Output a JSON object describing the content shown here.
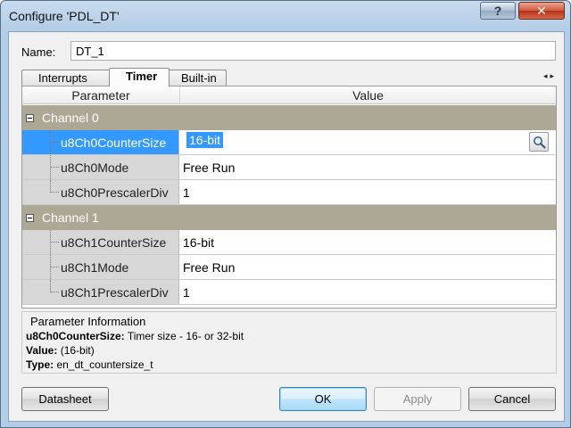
{
  "window": {
    "title": "Configure 'PDL_DT'",
    "help_label": "?",
    "close_label": "✕"
  },
  "name_field": {
    "label": "Name:",
    "value": "DT_1"
  },
  "tabs": [
    {
      "label": "Interrupts",
      "active": false
    },
    {
      "label": "Timer",
      "active": true
    },
    {
      "label": "Built-in",
      "active": false
    }
  ],
  "tab_scroll": "◂▸",
  "grid": {
    "headers": {
      "parameter": "Parameter",
      "value": "Value"
    },
    "categories": [
      {
        "label": "Channel 0",
        "rows": [
          {
            "name": "u8Ch0CounterSize",
            "value": "16-bit",
            "selected": true
          },
          {
            "name": "u8Ch0Mode",
            "value": "Free Run"
          },
          {
            "name": "u8Ch0PrescalerDiv",
            "value": "1"
          }
        ]
      },
      {
        "label": "Channel 1",
        "rows": [
          {
            "name": "u8Ch1CounterSize",
            "value": "16-bit"
          },
          {
            "name": "u8Ch1Mode",
            "value": "Free Run"
          },
          {
            "name": "u8Ch1PrescalerDiv",
            "value": "1"
          }
        ]
      }
    ]
  },
  "info": {
    "title": "Parameter Information",
    "name_label": "u8Ch0CounterSize:",
    "name_desc": "Timer size - 16- or 32-bit",
    "value_label": "Value:",
    "value_text": "(16-bit)",
    "type_label": "Type:",
    "type_text": "en_dt_countersize_t"
  },
  "buttons": {
    "datasheet": "Datasheet",
    "ok": "OK",
    "apply": "Apply",
    "cancel": "Cancel"
  }
}
